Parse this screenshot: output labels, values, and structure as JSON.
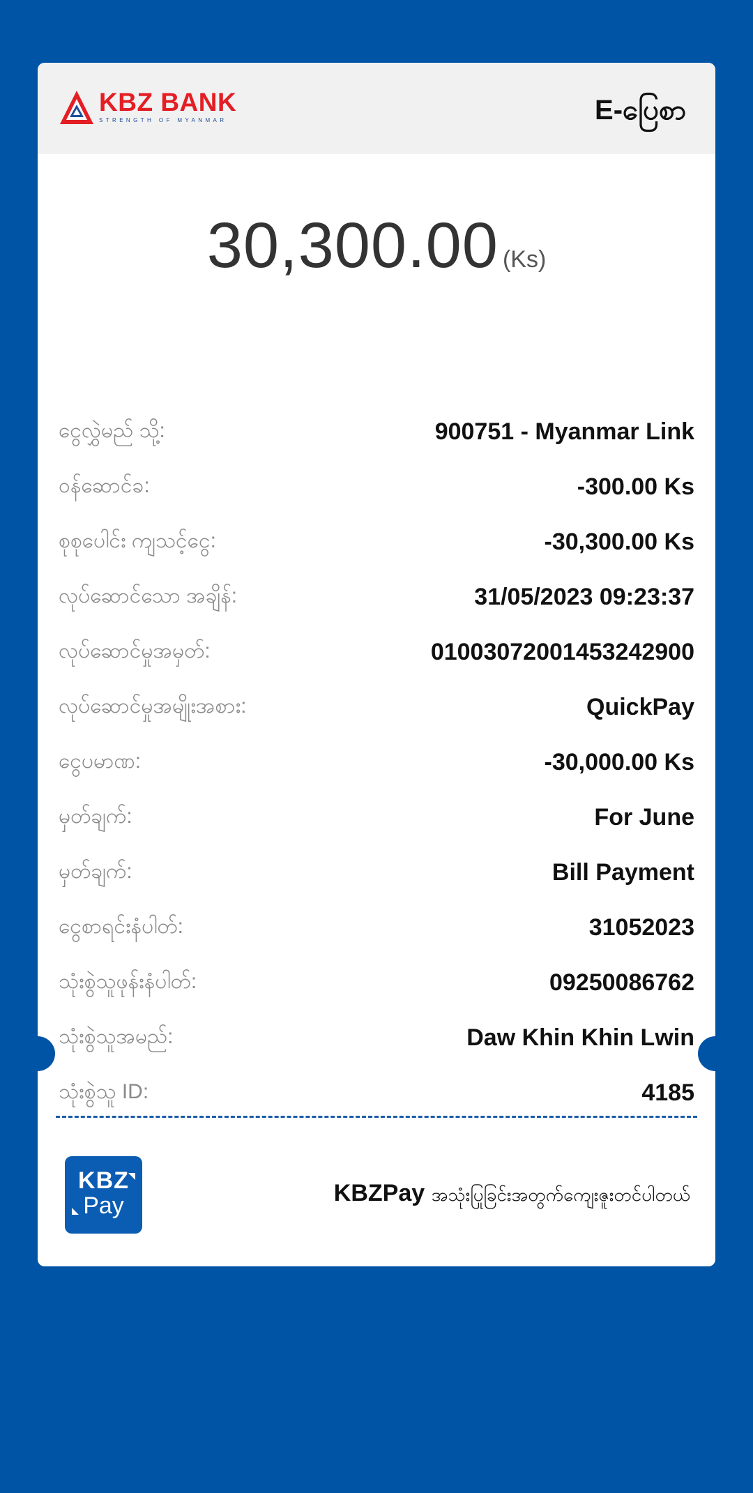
{
  "header": {
    "logo_name": "KBZ BANK",
    "logo_tagline": "STRENGTH OF MYANMAR",
    "title": "E-ပြေစာ"
  },
  "amount": {
    "value": "30,300.00",
    "unit": "(Ks)"
  },
  "rows": [
    {
      "label": "ငွေလွှဲမည် သို့:",
      "value": "900751 - Myanmar Link"
    },
    {
      "label": "ဝန်ဆောင်ခ:",
      "value": "-300.00 Ks"
    },
    {
      "label": "စုစုပေါင်း ကျသင့်ငွေ:",
      "value": "-30,300.00 Ks"
    },
    {
      "label": "လုပ်ဆောင်သော အချိန်:",
      "value": "31/05/2023 09:23:37"
    },
    {
      "label": "လုပ်ဆောင်မှုအမှတ်:",
      "value": "01003072001453242900"
    },
    {
      "label": "လုပ်ဆောင်မှုအမျိုးအစား:",
      "value": "QuickPay"
    },
    {
      "label": "ငွေပမာဏ:",
      "value": "-30,000.00 Ks"
    },
    {
      "label": "မှတ်ချက်:",
      "value": "For June"
    },
    {
      "label": "မှတ်ချက်:",
      "value": "Bill Payment"
    },
    {
      "label": "ငွေစာရင်းနံပါတ်:",
      "value": "31052023"
    },
    {
      "label": "သုံးစွဲသူဖုန်းနံပါတ်:",
      "value": "09250086762"
    },
    {
      "label": "သုံးစွဲသူအမည်:",
      "value": "Daw Khin Khin Lwin"
    },
    {
      "label": "သုံးစွဲသူ ID:",
      "value": "4185"
    }
  ],
  "footer": {
    "badge_top": "KBZ",
    "badge_bottom": "Pay",
    "brand": "KBZPay",
    "message": "အသုံးပြုခြင်းအတွက်ကျေးဇူးတင်ပါတယ်"
  },
  "colors": {
    "background": "#0054a6",
    "brand_red": "#e31e24",
    "brand_blue": "#1f4e9c",
    "badge_blue": "#0b5cb3"
  }
}
